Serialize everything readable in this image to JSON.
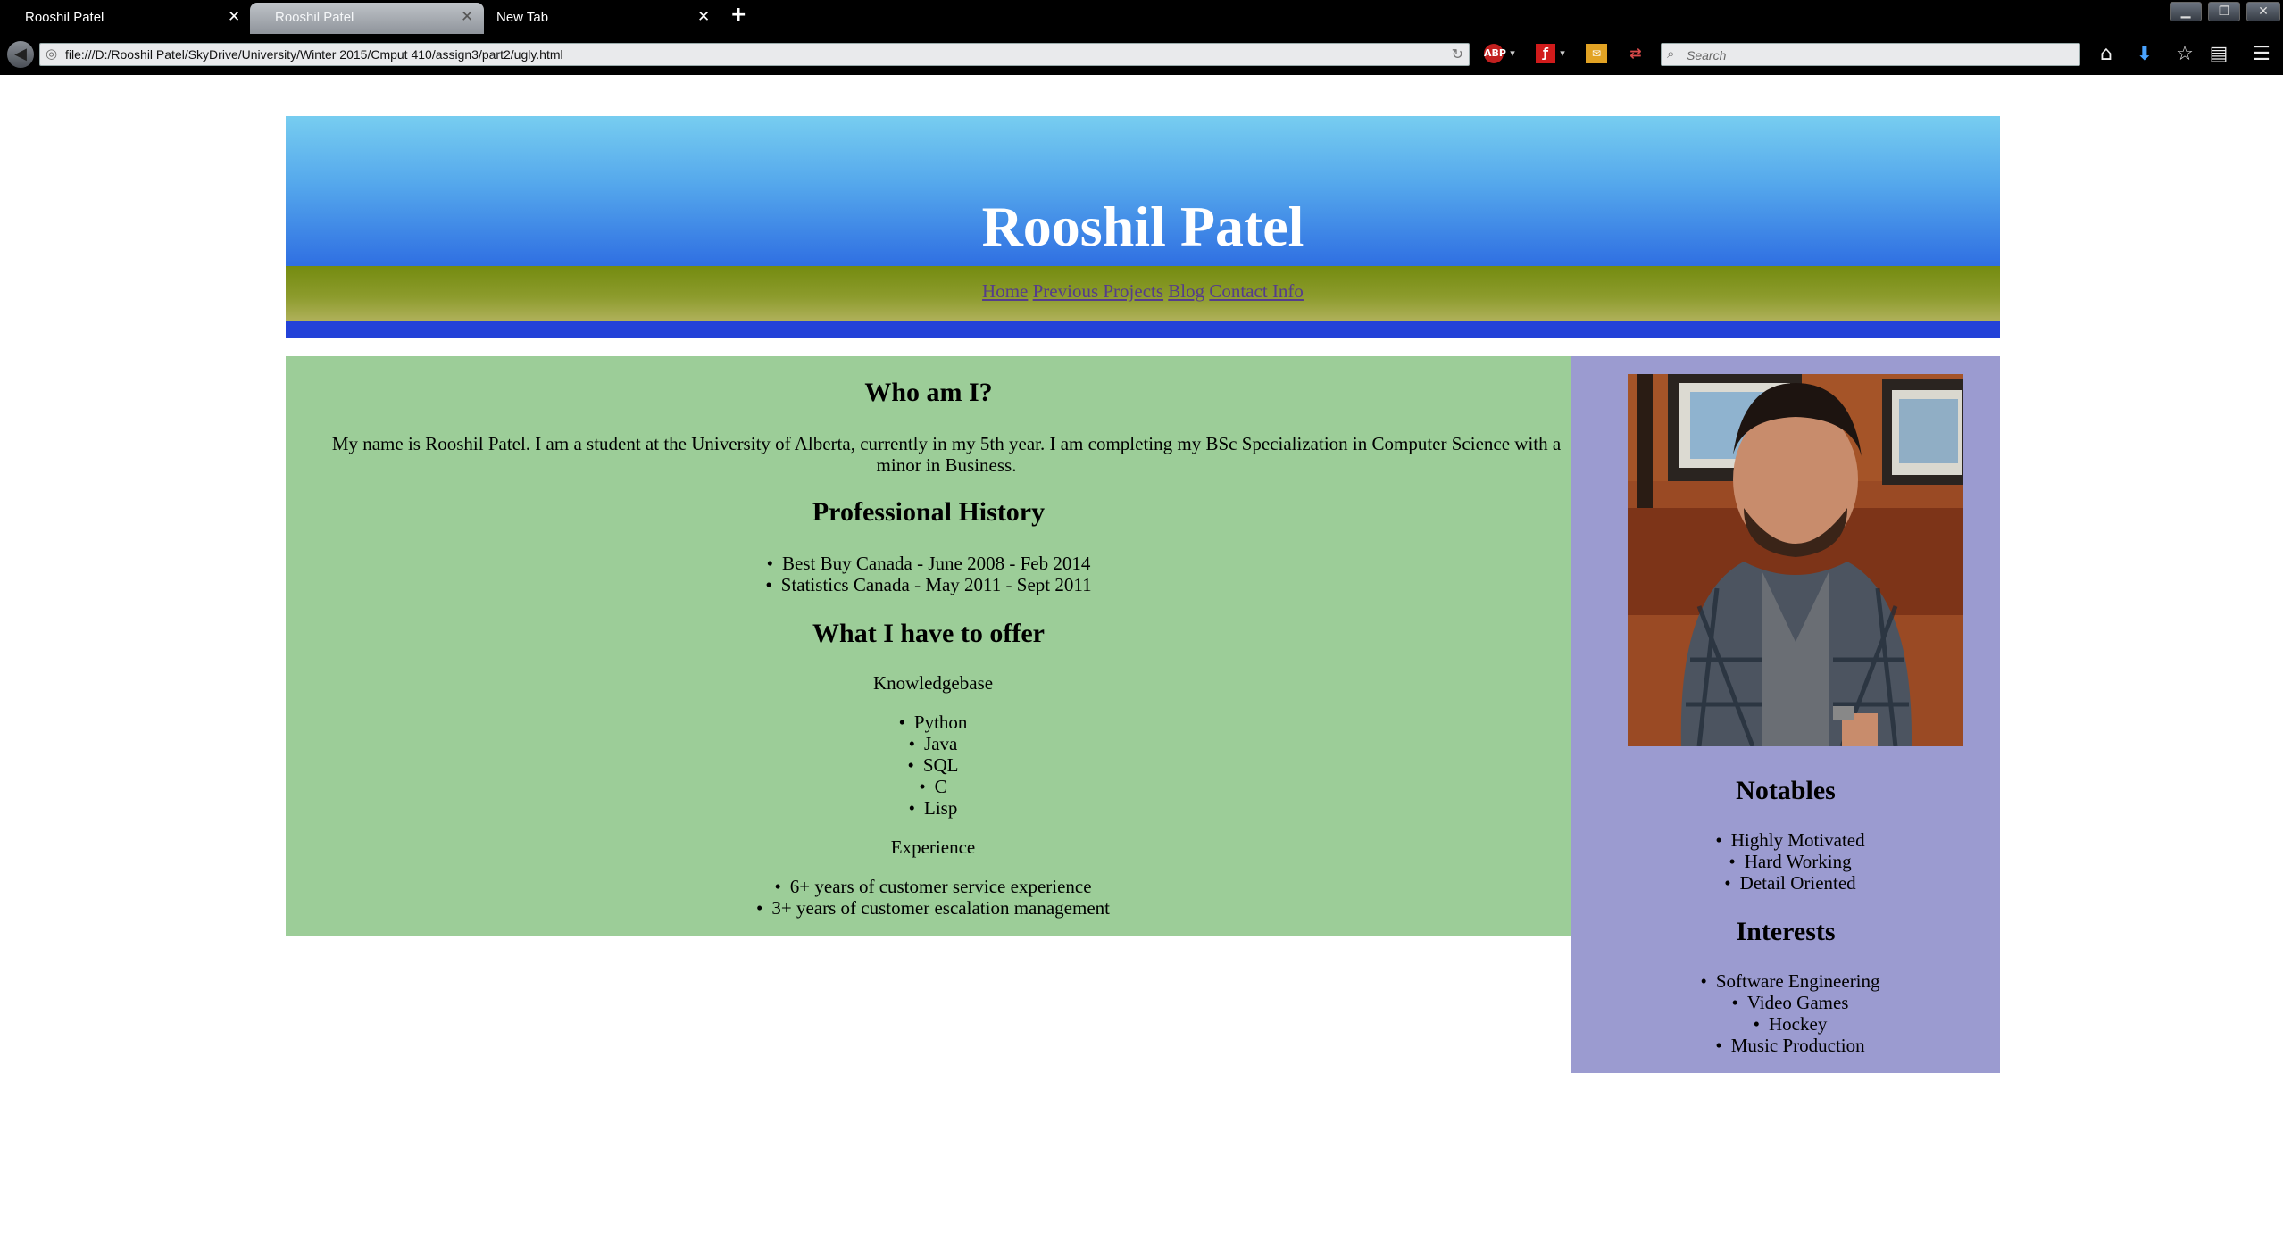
{
  "browser": {
    "tabs": [
      {
        "title": "Rooshil Patel",
        "active": false
      },
      {
        "title": "Rooshil Patel",
        "active": true
      },
      {
        "title": "New Tab",
        "active": false
      }
    ],
    "url": "file:///D:/Rooshil Patel/SkyDrive/University/Winter 2015/Cmput 410/assign3/part2/ugly.html",
    "search_placeholder": "Search",
    "icons": {
      "new_tab": "plus-icon",
      "back": "back-arrow-icon",
      "reload": "reload-icon",
      "adblock": "adblock-icon",
      "flash": "flash-icon",
      "home": "home-icon",
      "downloads": "download-icon",
      "bookmarks": "star-icon",
      "library": "clipboard-icon",
      "menu": "hamburger-menu-icon"
    }
  },
  "site": {
    "title": "Rooshil Patel",
    "nav": [
      "Home",
      "Previous Projects",
      "Blog",
      "Contact Info"
    ],
    "colors": {
      "header_top": "#77cdf0",
      "header_bottom": "#2f6fe2",
      "nav_bar": "#8c9b2c",
      "nav_link": "#553c8b",
      "blue_bar": "#2342d8",
      "main_bg": "#9ccd98",
      "sidebar_bg": "#9b9bd0"
    }
  },
  "main": {
    "who_heading": "Who am I?",
    "who_text": "My name is Rooshil Patel. I am a student at the University of Alberta, currently in my 5th year. I am completing my BSc Specialization in Computer Science with a minor in Business.",
    "history_heading": "Professional History",
    "history": [
      "Best Buy Canada - June 2008 - Feb 2014",
      "Statistics Canada - May 2011 - Sept 2011"
    ],
    "offer_heading": "What I have to offer",
    "knowledge_label": "Knowledgebase",
    "knowledge": [
      "Python",
      "Java",
      "SQL",
      "C",
      "Lisp"
    ],
    "experience_label": "Experience",
    "experience": [
      "6+ years of customer service experience",
      "3+ years of customer escalation management"
    ]
  },
  "sidebar": {
    "notables_heading": "Notables",
    "notables": [
      "Highly Motivated",
      "Hard Working",
      "Detail Oriented"
    ],
    "interests_heading": "Interests",
    "interests": [
      "Software Engineering",
      "Video Games",
      "Hockey",
      "Music Production"
    ]
  }
}
